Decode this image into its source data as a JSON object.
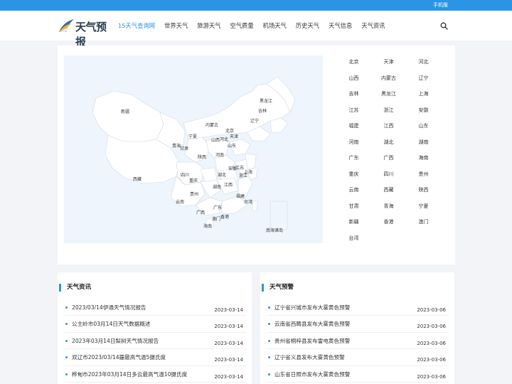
{
  "topbar": {
    "mobile_label": "手机版"
  },
  "header": {
    "logo_text": "天气预报",
    "nav": [
      {
        "label": "15天气查询网",
        "active": true
      },
      {
        "label": "世界天气"
      },
      {
        "label": "旅游天气"
      },
      {
        "label": "空气质量"
      },
      {
        "label": "机场天气"
      },
      {
        "label": "历史天气"
      },
      {
        "label": "天气信息"
      },
      {
        "label": "天气资讯"
      }
    ]
  },
  "map": {
    "labels": [
      "新疆",
      "西藏",
      "青海",
      "甘肃",
      "宁夏",
      "内蒙古",
      "北京",
      "天津",
      "山西",
      "河北",
      "辽宁",
      "吉林",
      "黑龙江",
      "陕西",
      "河南",
      "山东",
      "江苏",
      "安徽",
      "上海",
      "浙江",
      "四川",
      "重庆",
      "湖北",
      "湖南",
      "江西",
      "贵州",
      "云南",
      "广西",
      "广东",
      "福建",
      "台湾",
      "澳门",
      "香港",
      "海南",
      "南海诸岛"
    ]
  },
  "provinces": [
    "北京",
    "天津",
    "河北",
    "山西",
    "内蒙古",
    "辽宁",
    "吉林",
    "黑龙江",
    "上海",
    "江苏",
    "浙江",
    "安徽",
    "福建",
    "江西",
    "山东",
    "河南",
    "湖北",
    "湖南",
    "广东",
    "广西",
    "海南",
    "重庆",
    "四川",
    "贵州",
    "云南",
    "西藏",
    "陕西",
    "甘肃",
    "青海",
    "宁夏",
    "新疆",
    "香港",
    "澳门",
    "台湾"
  ],
  "news": {
    "title": "天气资讯",
    "items": [
      {
        "title": "2023/03/14伊通天气情况报告",
        "date": "2023-03-14"
      },
      {
        "title": "公主岭市03月14日天气数据概述",
        "date": "2023-03-14"
      },
      {
        "title": "2023年03月14日梨树天气情况报告",
        "date": "2023-03-14"
      },
      {
        "title": "双辽市2023/03/14霾最高气温5摄氏度",
        "date": "2023-03-14"
      },
      {
        "title": "桦甸市2023年03月14日多云最高气温10摄氏度",
        "date": "2023-03-14"
      }
    ]
  },
  "warnings": {
    "title": "天气预警",
    "items": [
      {
        "title": "辽宁省兴城市发布大雾黄色预警",
        "date": "2023-03-06"
      },
      {
        "title": "云南省西畴县发布大雾黄色预警",
        "date": "2023-03-06"
      },
      {
        "title": "贵州省桐梓县发布雷电黄色预警",
        "date": "2023-03-06"
      },
      {
        "title": "辽宁省义县发布大雾黄色预警",
        "date": "2023-03-06"
      },
      {
        "title": "山东省日照市发布大雾黄色预警",
        "date": "2023-03-06"
      }
    ]
  },
  "colors": {
    "accent": "#2b95e5",
    "map_bg": "#eef5fc"
  }
}
